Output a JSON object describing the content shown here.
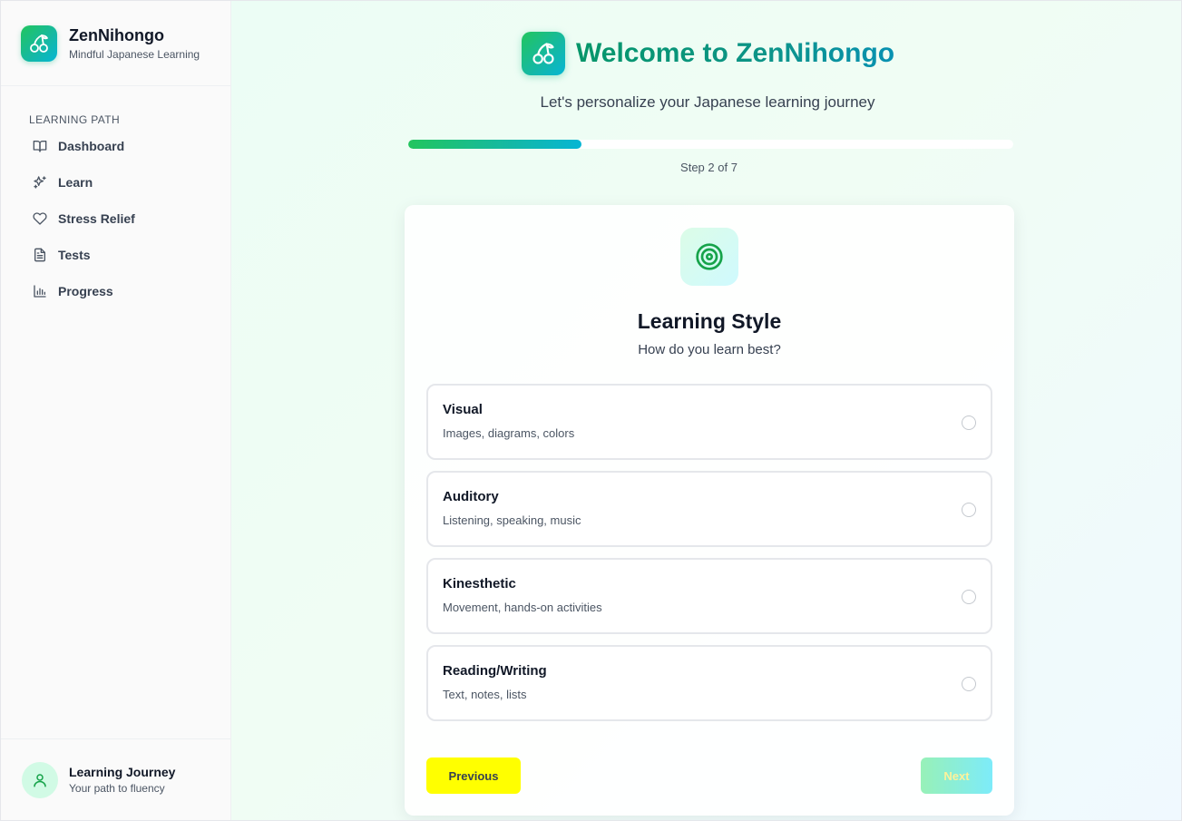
{
  "brand": {
    "title": "ZenNihongo",
    "subtitle": "Mindful Japanese Learning",
    "logo_icon": "cherry-icon"
  },
  "sidebar": {
    "section_label": "LEARNING PATH",
    "items": [
      {
        "label": "Dashboard",
        "icon": "book-open-icon"
      },
      {
        "label": "Learn",
        "icon": "sparkles-icon"
      },
      {
        "label": "Stress Relief",
        "icon": "heart-icon"
      },
      {
        "label": "Tests",
        "icon": "file-text-icon"
      },
      {
        "label": "Progress",
        "icon": "bar-chart-icon"
      }
    ],
    "footer": {
      "title": "Learning Journey",
      "subtitle": "Your path to fluency",
      "icon": "user-icon"
    }
  },
  "main": {
    "welcome_title": "Welcome to ZenNihongo",
    "subtitle": "Let's personalize your Japanese learning journey",
    "progress": {
      "current": 2,
      "total": 7,
      "label": "Step 2 of 7"
    },
    "card": {
      "icon": "target-icon",
      "title": "Learning Style",
      "question": "How do you learn best?",
      "options": [
        {
          "title": "Visual",
          "description": "Images, diagrams, colors"
        },
        {
          "title": "Auditory",
          "description": "Listening, speaking, music"
        },
        {
          "title": "Kinesthetic",
          "description": "Movement, hands-on activities"
        },
        {
          "title": "Reading/Writing",
          "description": "Text, notes, lists"
        }
      ],
      "previous_label": "Previous",
      "next_label": "Next"
    }
  },
  "colors": {
    "accent_green": "#22c55e",
    "accent_teal": "#14b8a6",
    "accent_cyan": "#06b6d4",
    "previous_button": "#ffff00"
  }
}
